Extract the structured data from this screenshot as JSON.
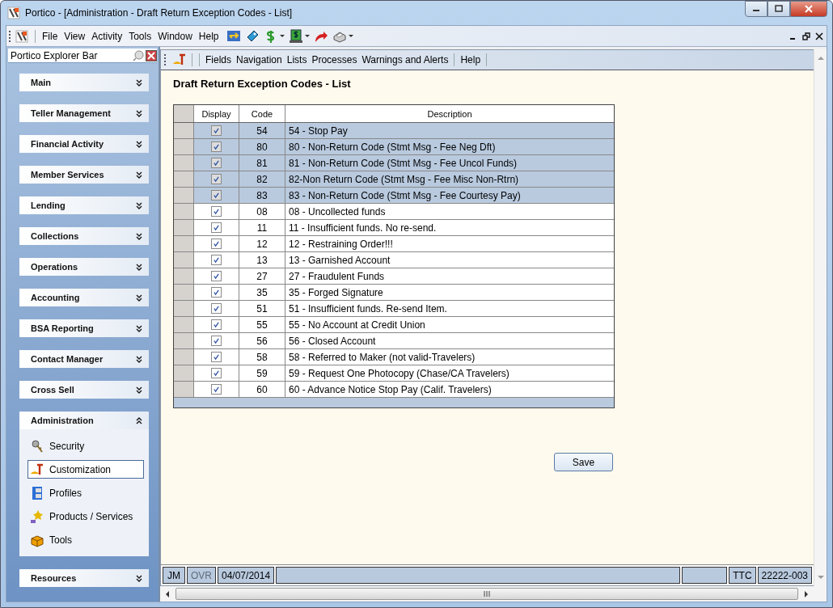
{
  "window": {
    "title": "Portico - [Administration - Draft Return Exception Codes - List]"
  },
  "menu_bar": [
    "File",
    "View",
    "Activity",
    "Tools",
    "Window",
    "Help"
  ],
  "explorer_bar": {
    "title": "Portico Explorer Bar",
    "groups": [
      {
        "label": "Main",
        "expanded": false
      },
      {
        "label": "Teller Management",
        "expanded": false
      },
      {
        "label": "Financial Activity",
        "expanded": false
      },
      {
        "label": "Member Services",
        "expanded": false
      },
      {
        "label": "Lending",
        "expanded": false
      },
      {
        "label": "Collections",
        "expanded": false
      },
      {
        "label": "Operations",
        "expanded": false
      },
      {
        "label": "Accounting",
        "expanded": false
      },
      {
        "label": "BSA Reporting",
        "expanded": false
      },
      {
        "label": "Contact Manager",
        "expanded": false
      },
      {
        "label": "Cross Sell",
        "expanded": false
      },
      {
        "label": "Administration",
        "expanded": true,
        "items": [
          {
            "label": "Security",
            "selected": false
          },
          {
            "label": "Customization",
            "selected": true
          },
          {
            "label": "Profiles",
            "selected": false
          },
          {
            "label": "Products / Services",
            "selected": false
          },
          {
            "label": "Tools",
            "selected": false
          }
        ]
      },
      {
        "label": "Resources",
        "expanded": false
      }
    ]
  },
  "form_toolbar": [
    "Fields",
    "Navigation",
    "Lists",
    "Processes",
    "Warnings and Alerts",
    "Help"
  ],
  "page_title": "Draft Return Exception Codes - List",
  "table": {
    "columns": [
      "Display",
      "Code",
      "Description"
    ],
    "rows": [
      {
        "checked": true,
        "selected": true,
        "code": "54",
        "description": "54 - Stop Pay"
      },
      {
        "checked": true,
        "selected": true,
        "code": "80",
        "description": "80 - Non-Return Code (Stmt Msg - Fee Neg Dft)"
      },
      {
        "checked": true,
        "selected": true,
        "code": "81",
        "description": "81 - Non-Return Code (Stmt Msg - Fee Uncol Funds)"
      },
      {
        "checked": true,
        "selected": true,
        "code": "82",
        "description": "82-Non Return Code (Stmt Msg - Fee Misc Non-Rtrn)"
      },
      {
        "checked": true,
        "selected": true,
        "code": "83",
        "description": "83 - Non-Return Code (Stmt Msg - Fee Courtesy Pay)"
      },
      {
        "checked": true,
        "selected": false,
        "code": "08",
        "description": "08 - Uncollected funds"
      },
      {
        "checked": true,
        "selected": false,
        "code": "11",
        "description": "11 - Insufficient funds. No re-send."
      },
      {
        "checked": true,
        "selected": false,
        "code": "12",
        "description": "12 - Restraining Order!!!"
      },
      {
        "checked": true,
        "selected": false,
        "code": "13",
        "description": "13 - Garnished Account"
      },
      {
        "checked": true,
        "selected": false,
        "code": "27",
        "description": "27 - Fraudulent Funds"
      },
      {
        "checked": true,
        "selected": false,
        "code": "35",
        "description": "35 - Forged Signature"
      },
      {
        "checked": true,
        "selected": false,
        "code": "51",
        "description": "51 - Insufficient funds. Re-send Item."
      },
      {
        "checked": true,
        "selected": false,
        "code": "55",
        "description": "55 - No Account at Credit Union"
      },
      {
        "checked": true,
        "selected": false,
        "code": "56",
        "description": "56 - Closed Account"
      },
      {
        "checked": true,
        "selected": false,
        "code": "58",
        "description": "58 - Referred to Maker (not valid-Travelers)"
      },
      {
        "checked": true,
        "selected": false,
        "code": "59",
        "description": "59 - Request One Photocopy (Chase/CA Travelers)"
      },
      {
        "checked": true,
        "selected": false,
        "code": "60",
        "description": "60 - Advance Notice Stop Pay (Calif. Travelers)"
      }
    ]
  },
  "save_button": "Save",
  "status_bar": [
    {
      "kind": "text",
      "text": "JM",
      "disabled": false
    },
    {
      "kind": "text",
      "text": "OVR",
      "disabled": true
    },
    {
      "kind": "text",
      "text": "04/07/2014",
      "disabled": false
    },
    {
      "kind": "wide"
    },
    {
      "kind": "blank"
    },
    {
      "kind": "text",
      "text": "TTC",
      "disabled": false
    },
    {
      "kind": "text",
      "text": "22222-003",
      "disabled": false
    }
  ]
}
